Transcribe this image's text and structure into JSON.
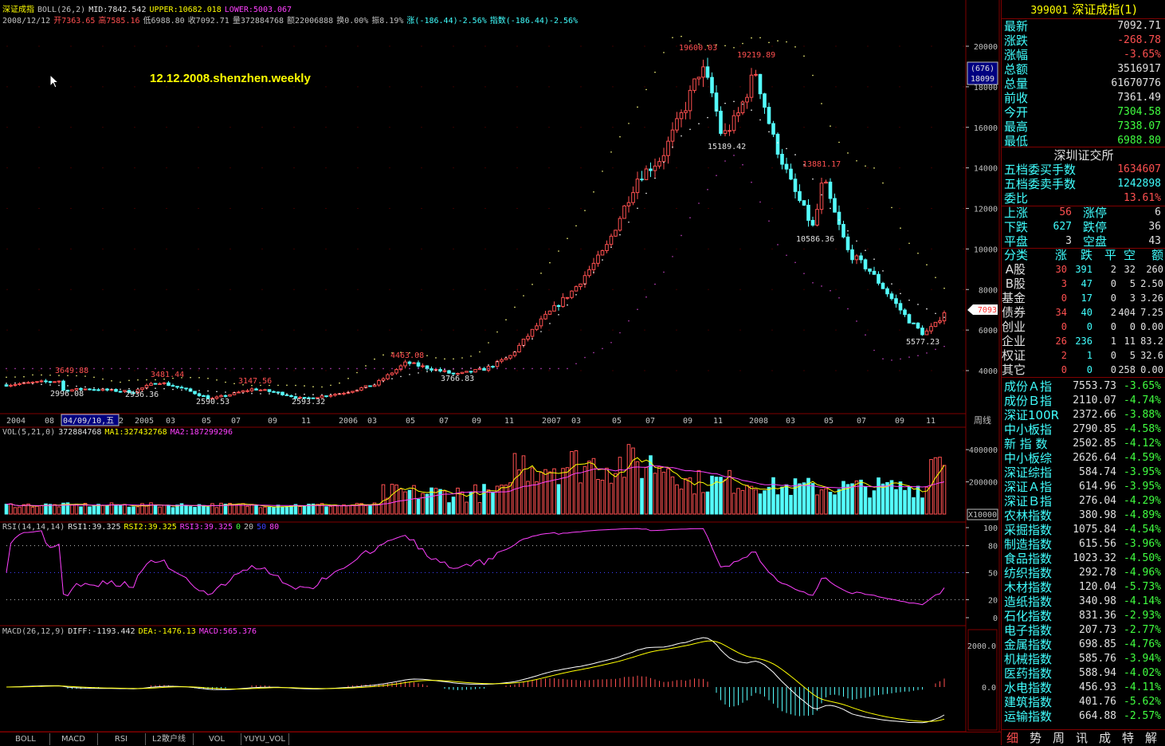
{
  "header": {
    "name": "深证成指",
    "boll_label": "BOLL(26,2)",
    "mid": "MID:7842.542",
    "upper": "UPPER:10682.018",
    "lower": "LOWER:5003.067",
    "date": "2008/12/12",
    "open": "开7363.65",
    "high": "高7585.16",
    "low": "低6988.80",
    "close": "收7092.71",
    "volume": "量372884768",
    "amount": "额22006888",
    "turnover": "换0.00%",
    "amplitude": "振8.19%",
    "change": "涨(-186.44)-2.56%",
    "index_change": "指数(-186.44)-2.56%"
  },
  "annotation": "12.12.2008.shenzhen.weekly",
  "price_axis": [
    "20000",
    "18000",
    "16000",
    "14000",
    "12000",
    "10000",
    "8000",
    "6000",
    "4000"
  ],
  "price_tag": "7093",
  "cursor_box": {
    "line1": "(676)",
    "line2": "18099"
  },
  "price_labels": [
    {
      "text": "3649.88",
      "x": 69,
      "y": 468,
      "color": "#ff5050"
    },
    {
      "text": "2996.08",
      "x": 63,
      "y": 497,
      "color": "#e0e0e0"
    },
    {
      "text": "3481.44",
      "x": 189,
      "y": 473,
      "color": "#ff5050"
    },
    {
      "text": "2936.36",
      "x": 157,
      "y": 498,
      "color": "#e0e0e0"
    },
    {
      "text": "2590.53",
      "x": 246,
      "y": 507,
      "color": "#e0e0e0"
    },
    {
      "text": "3147.56",
      "x": 299,
      "y": 481,
      "color": "#ff5050"
    },
    {
      "text": "2593.32",
      "x": 366,
      "y": 507,
      "color": "#e0e0e0"
    },
    {
      "text": "4463.08",
      "x": 490,
      "y": 449,
      "color": "#ff5050"
    },
    {
      "text": "3766.83",
      "x": 553,
      "y": 478,
      "color": "#e0e0e0"
    },
    {
      "text": "19600.03",
      "x": 852,
      "y": 63,
      "color": "#ff5050"
    },
    {
      "text": "15189.42",
      "x": 888,
      "y": 187,
      "color": "#e0e0e0"
    },
    {
      "text": "19219.89",
      "x": 925,
      "y": 72,
      "color": "#ff5050"
    },
    {
      "text": "13881.17",
      "x": 1007,
      "y": 209,
      "color": "#ff5050"
    },
    {
      "text": "10586.36",
      "x": 999,
      "y": 303,
      "color": "#e0e0e0"
    },
    {
      "text": "5577.23",
      "x": 1137,
      "y": 432,
      "color": "#e0e0e0"
    }
  ],
  "time_axis": [
    {
      "text": "2004",
      "x": 8,
      "color": "#c0c0c0"
    },
    {
      "text": "08",
      "x": 56,
      "color": "#c0c0c0"
    },
    {
      "text": "04/09/10,五",
      "x": 79,
      "color": "#e0e0e0",
      "box": true
    },
    {
      "text": "2",
      "x": 149,
      "color": "#c0c0c0"
    },
    {
      "text": "2005",
      "x": 169,
      "color": "#c0c0c0"
    },
    {
      "text": "03",
      "x": 208,
      "color": "#c0c0c0"
    },
    {
      "text": "05",
      "x": 253,
      "color": "#c0c0c0"
    },
    {
      "text": "07",
      "x": 290,
      "color": "#c0c0c0"
    },
    {
      "text": "09",
      "x": 336,
      "color": "#c0c0c0"
    },
    {
      "text": "11",
      "x": 378,
      "color": "#c0c0c0"
    },
    {
      "text": "2006",
      "x": 425,
      "color": "#c0c0c0"
    },
    {
      "text": "03",
      "x": 461,
      "color": "#c0c0c0"
    },
    {
      "text": "05",
      "x": 509,
      "color": "#c0c0c0"
    },
    {
      "text": "07",
      "x": 551,
      "color": "#c0c0c0"
    },
    {
      "text": "09",
      "x": 592,
      "color": "#c0c0c0"
    },
    {
      "text": "11",
      "x": 633,
      "color": "#c0c0c0"
    },
    {
      "text": "2007",
      "x": 680,
      "color": "#c0c0c0"
    },
    {
      "text": "03",
      "x": 717,
      "color": "#c0c0c0"
    },
    {
      "text": "05",
      "x": 768,
      "color": "#c0c0c0"
    },
    {
      "text": "07",
      "x": 810,
      "color": "#c0c0c0"
    },
    {
      "text": "09",
      "x": 857,
      "color": "#c0c0c0"
    },
    {
      "text": "11",
      "x": 895,
      "color": "#c0c0c0"
    },
    {
      "text": "2008",
      "x": 940,
      "color": "#c0c0c0"
    },
    {
      "text": "03",
      "x": 986,
      "color": "#c0c0c0"
    },
    {
      "text": "05",
      "x": 1034,
      "color": "#c0c0c0"
    },
    {
      "text": "07",
      "x": 1075,
      "color": "#c0c0c0"
    },
    {
      "text": "09",
      "x": 1123,
      "color": "#c0c0c0"
    },
    {
      "text": "11",
      "x": 1162,
      "color": "#c0c0c0"
    }
  ],
  "period_label": "周线",
  "vol_header": {
    "name": "VOL(5,21,0)",
    "value": "372884768",
    "ma1": "MA1:327432768",
    "ma2": "MA2:187299296"
  },
  "vol_axis": [
    "400000",
    "200000"
  ],
  "vol_unit": "X10000",
  "rsi_header": {
    "name": "RSI(14,14,14)",
    "rsi1": "RSI1:39.325",
    "rsi2": "RSI2:39.325",
    "rsi3": "RSI3:39.325",
    "l0": "0",
    "l20": "20",
    "l50": "50",
    "l80": "80"
  },
  "rsi_axis": [
    "100",
    "80",
    "50",
    "20",
    "0"
  ],
  "macd_header": {
    "name": "MACD(26,12,9)",
    "diff": "DIFF:-1193.442",
    "dea": "DEA:-1476.13",
    "macd": "MACD:565.376"
  },
  "macd_axis": [
    "2000.0",
    "0.0"
  ],
  "bottom_tabs": [
    "BOLL",
    "MACD",
    "RSI",
    "L2散户线",
    "VOL",
    "YUYU_VOL"
  ],
  "chart_data": {
    "type": "candlestick",
    "title": "深证成指",
    "period": "weekly",
    "x_range": [
      "2004-01",
      "2008-12-12"
    ],
    "y_range": [
      4000,
      21000
    ],
    "key_points": [
      {
        "date": "2004-04",
        "value": 3649.88,
        "kind": "high"
      },
      {
        "date": "2004-09",
        "value": 2996.08,
        "kind": "low"
      },
      {
        "date": "2005-02",
        "value": 3481.44,
        "kind": "high"
      },
      {
        "date": "2005-01",
        "value": 2936.36,
        "kind": "low"
      },
      {
        "date": "2005-06",
        "value": 2590.53,
        "kind": "low"
      },
      {
        "date": "2005-09",
        "value": 3147.56,
        "kind": "high"
      },
      {
        "date": "2005-12",
        "value": 2593.32,
        "kind": "low"
      },
      {
        "date": "2006-05",
        "value": 4463.08,
        "kind": "high"
      },
      {
        "date": "2006-08",
        "value": 3766.83,
        "kind": "low"
      },
      {
        "date": "2007-10",
        "value": 19600.03,
        "kind": "high"
      },
      {
        "date": "2007-11",
        "value": 15189.42,
        "kind": "low"
      },
      {
        "date": "2008-01",
        "value": 19219.89,
        "kind": "high"
      },
      {
        "date": "2008-04",
        "value": 10586.36,
        "kind": "low"
      },
      {
        "date": "2008-05",
        "value": 13881.17,
        "kind": "high"
      },
      {
        "date": "2008-11",
        "value": 5577.23,
        "kind": "low"
      },
      {
        "date": "2008-12-12",
        "value": 7092.71,
        "kind": "close"
      }
    ]
  },
  "side": {
    "title_code": "399001",
    "title_name": "深证成指(1)",
    "quote": [
      {
        "label": "最新",
        "value": "7092.71",
        "color": "#e0e0e0"
      },
      {
        "label": "涨跌",
        "value": "-268.78",
        "color": "#ff5050"
      },
      {
        "label": "涨幅",
        "value": "-3.65%",
        "color": "#ff5050"
      },
      {
        "label": "总额",
        "value": "3516917",
        "color": "#e0e0e0"
      },
      {
        "label": "总量",
        "value": "61670776",
        "color": "#e0e0e0"
      },
      {
        "label": "前收",
        "value": "7361.49",
        "color": "#e0e0e0"
      },
      {
        "label": "今开",
        "value": "7304.58",
        "color": "#40ff40"
      },
      {
        "label": "最高",
        "value": "7338.07",
        "color": "#40ff40"
      },
      {
        "label": "最低",
        "value": "6988.80",
        "color": "#40ff40"
      }
    ],
    "exchange": "深圳证交所",
    "orders": [
      {
        "label": "五档委买手数",
        "value": "1634607",
        "color": "#ff5050"
      },
      {
        "label": "五档委卖手数",
        "value": "1242898",
        "color": "#40ffff"
      },
      {
        "label": "委比",
        "value": "13.61%",
        "color": "#ff5050"
      }
    ],
    "breadth": [
      {
        "l1": "上涨",
        "v1": "56",
        "l2": "涨停",
        "v2": "6",
        "c1": "#ff5050"
      },
      {
        "l1": "下跌",
        "v1": "627",
        "l2": "跌停",
        "v2": "36",
        "c1": "#40ffff"
      },
      {
        "l1": "平盘",
        "v1": "3",
        "l2": "空盘",
        "v2": "43",
        "c1": "#e0e0e0"
      }
    ],
    "cat_header": [
      "分类",
      "涨",
      "跌",
      "平",
      "空",
      "额"
    ],
    "cats": [
      {
        "name": "A股",
        "up": "30",
        "down": "391",
        "flat": "2",
        "empty": "32",
        "amt": "260"
      },
      {
        "name": "B股",
        "up": "3",
        "down": "47",
        "flat": "0",
        "empty": "5",
        "amt": "2.50"
      },
      {
        "name": "基金",
        "up": "0",
        "down": "17",
        "flat": "0",
        "empty": "3",
        "amt": "3.26"
      },
      {
        "name": "债券",
        "up": "34",
        "down": "40",
        "flat": "2",
        "empty": "404",
        "amt": "7.25"
      },
      {
        "name": "创业",
        "up": "0",
        "down": "0",
        "flat": "0",
        "empty": "0",
        "amt": "0.00"
      },
      {
        "name": "企业",
        "up": "26",
        "down": "236",
        "flat": "1",
        "empty": "11",
        "amt": "83.2"
      },
      {
        "name": "权证",
        "up": "2",
        "down": "1",
        "flat": "0",
        "empty": "5",
        "amt": "32.6"
      },
      {
        "name": "其它",
        "up": "0",
        "down": "0",
        "flat": "0",
        "empty": "258",
        "amt": "0.00"
      }
    ],
    "indices": [
      {
        "name": "成份Ａ指",
        "value": "7553.73",
        "pct": "-3.65%"
      },
      {
        "name": "成份Ｂ指",
        "value": "2110.07",
        "pct": "-4.74%"
      },
      {
        "name": "深证100R",
        "value": "2372.66",
        "pct": "-3.88%"
      },
      {
        "name": "中小板指",
        "value": "2790.85",
        "pct": "-4.58%"
      },
      {
        "name": "新 指 数",
        "value": "2502.85",
        "pct": "-4.12%"
      },
      {
        "name": "中小板综",
        "value": "2626.64",
        "pct": "-4.59%"
      },
      {
        "name": "深证综指",
        "value": "584.74",
        "pct": "-3.95%"
      },
      {
        "name": "深证Ａ指",
        "value": "614.96",
        "pct": "-3.95%"
      },
      {
        "name": "深证Ｂ指",
        "value": "276.04",
        "pct": "-4.29%"
      },
      {
        "name": "农林指数",
        "value": "380.98",
        "pct": "-4.89%"
      },
      {
        "name": "采掘指数",
        "value": "1075.84",
        "pct": "-4.54%"
      },
      {
        "name": "制造指数",
        "value": "615.56",
        "pct": "-3.96%"
      },
      {
        "name": "食品指数",
        "value": "1023.32",
        "pct": "-4.50%"
      },
      {
        "name": "纺织指数",
        "value": "292.78",
        "pct": "-4.96%"
      },
      {
        "name": "木材指数",
        "value": "120.04",
        "pct": "-5.73%"
      },
      {
        "name": "造纸指数",
        "value": "340.98",
        "pct": "-4.14%"
      },
      {
        "name": "石化指数",
        "value": "831.36",
        "pct": "-2.93%"
      },
      {
        "name": "电子指数",
        "value": "207.73",
        "pct": "-2.77%"
      },
      {
        "name": "金属指数",
        "value": "698.85",
        "pct": "-4.76%"
      },
      {
        "name": "机械指数",
        "value": "585.76",
        "pct": "-3.94%"
      },
      {
        "name": "医药指数",
        "value": "588.94",
        "pct": "-4.02%"
      },
      {
        "name": "水电指数",
        "value": "456.93",
        "pct": "-4.11%"
      },
      {
        "name": "建筑指数",
        "value": "401.76",
        "pct": "-5.62%"
      },
      {
        "name": "运输指数",
        "value": "664.88",
        "pct": "-2.57%"
      }
    ],
    "tabs": [
      "细",
      "势",
      "周",
      "讯",
      "成",
      "特",
      "解"
    ]
  },
  "colors": {
    "up": "#ff5050",
    "down": "#54fcfc",
    "frame": "#800000",
    "ma_white": "#ffffff",
    "ma_yellow": "#ffff00",
    "ma_magenta": "#ff40ff"
  }
}
